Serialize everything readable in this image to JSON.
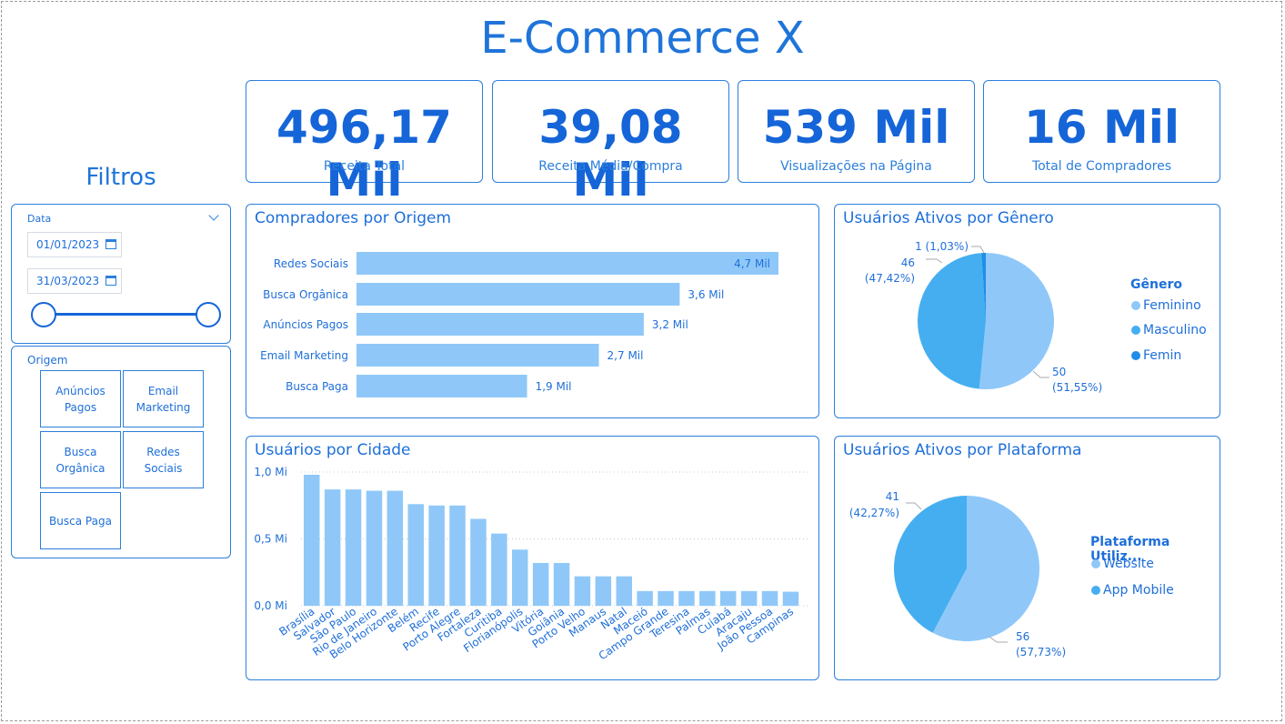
{
  "title": "E-Commerce X",
  "kpis": [
    {
      "value": "496,17 Mil",
      "label": "Receita Total"
    },
    {
      "value": "39,08 Mil",
      "label": "Receita Média/Compra"
    },
    {
      "value": "539 Mil",
      "label": "Visualizações na Página"
    },
    {
      "value": "16 Mil",
      "label": "Total de Compradores"
    }
  ],
  "filters": {
    "title": "Filtros",
    "date": {
      "label": "Data",
      "start": "01/01/2023",
      "end": "31/03/2023"
    },
    "origin": {
      "label": "Origem",
      "options": [
        "Anúncios Pagos",
        "Email Marketing",
        "Busca Orgânica",
        "Redes Sociais",
        "Busca Paga"
      ]
    }
  },
  "colors": {
    "accent": "#1e74d9",
    "bar": "#8fc8f8",
    "light_blue": "#8fc8f8",
    "mid_blue": "#45aef0",
    "dark_blue": "#1f8ee8"
  },
  "chart_data": [
    {
      "type": "bar",
      "orientation": "horizontal",
      "title": "Compradores por Origem",
      "categories": [
        "Redes Sociais",
        "Busca Orgânica",
        "Anúncios Pagos",
        "Email Marketing",
        "Busca Paga"
      ],
      "values": [
        4.7,
        3.6,
        3.2,
        2.7,
        1.9
      ],
      "data_labels": [
        "4,7 Mil",
        "3,6 Mil",
        "3,2 Mil",
        "2,7 Mil",
        "1,9 Mil"
      ],
      "unit": "Mil"
    },
    {
      "type": "pie",
      "title": "Usuários Ativos por Gênero",
      "legend_title": "Gênero",
      "legend": [
        "Feminino",
        "Masculino",
        "Femin"
      ],
      "values": [
        50,
        46,
        1
      ],
      "data_labels": [
        [
          "50",
          "(51,55%)"
        ],
        [
          "46",
          "(47,42%)"
        ],
        [
          "1 (1,03%)"
        ]
      ],
      "legend_placement": "right"
    },
    {
      "type": "bar",
      "orientation": "vertical",
      "title": "Usuários por Cidade",
      "categories": [
        "Brasília",
        "Salvador",
        "São Paulo",
        "Rio de Janeiro",
        "Belo Horizonte",
        "Belém",
        "Recife",
        "Porto Alegre",
        "Fortaleza",
        "Curitiba",
        "Florianópolis",
        "Vitória",
        "Goiânia",
        "Porto Velho",
        "Manaus",
        "Natal",
        "Maceió",
        "Campo Grande",
        "Teresina",
        "Palmas",
        "Cuiabá",
        "Aracaju",
        "João Pessoa",
        "Campinas"
      ],
      "values": [
        0.98,
        0.87,
        0.87,
        0.86,
        0.86,
        0.76,
        0.75,
        0.75,
        0.65,
        0.54,
        0.42,
        0.32,
        0.32,
        0.22,
        0.22,
        0.22,
        0.11,
        0.11,
        0.11,
        0.11,
        0.11,
        0.11,
        0.11,
        0.105
      ],
      "y_ticks": [
        "0,0 Mi",
        "0,5 Mi",
        "1,0 Mi"
      ],
      "ylim": [
        0,
        1.0
      ],
      "grid": true
    },
    {
      "type": "pie",
      "title": "Usuários Ativos por Plataforma",
      "legend_title": "Plataforma Utiliz...",
      "legend": [
        "Website",
        "App Mobile"
      ],
      "values": [
        56,
        41
      ],
      "data_labels": [
        [
          "56",
          "(57,73%)"
        ],
        [
          "41",
          "(42,27%)"
        ]
      ],
      "legend_placement": "right"
    }
  ]
}
